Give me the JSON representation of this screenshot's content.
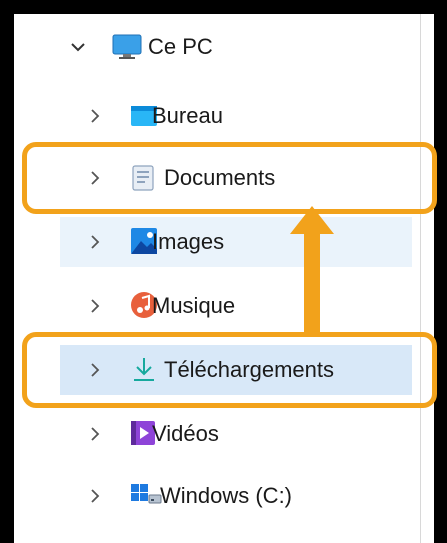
{
  "tree": {
    "root": {
      "label": "Ce PC",
      "icon": "monitor-icon",
      "expanded": true
    },
    "items": [
      {
        "label": "Bureau",
        "icon": "desktop-folder-icon"
      },
      {
        "label": "Documents",
        "icon": "documents-folder-icon"
      },
      {
        "label": "Images",
        "icon": "pictures-folder-icon"
      },
      {
        "label": "Musique",
        "icon": "music-folder-icon"
      },
      {
        "label": "Téléchargements",
        "icon": "downloads-folder-icon",
        "selected": true
      },
      {
        "label": "Vidéos",
        "icon": "videos-folder-icon"
      },
      {
        "label": "Windows  (C:)",
        "icon": "windows-drive-icon"
      }
    ]
  },
  "annotation": {
    "color": "#f2a21b",
    "arrow": "from Téléchargements to Documents"
  },
  "colors": {
    "selected_bg": "#d8e8f8",
    "hover_bg": "#eaf3fb"
  }
}
